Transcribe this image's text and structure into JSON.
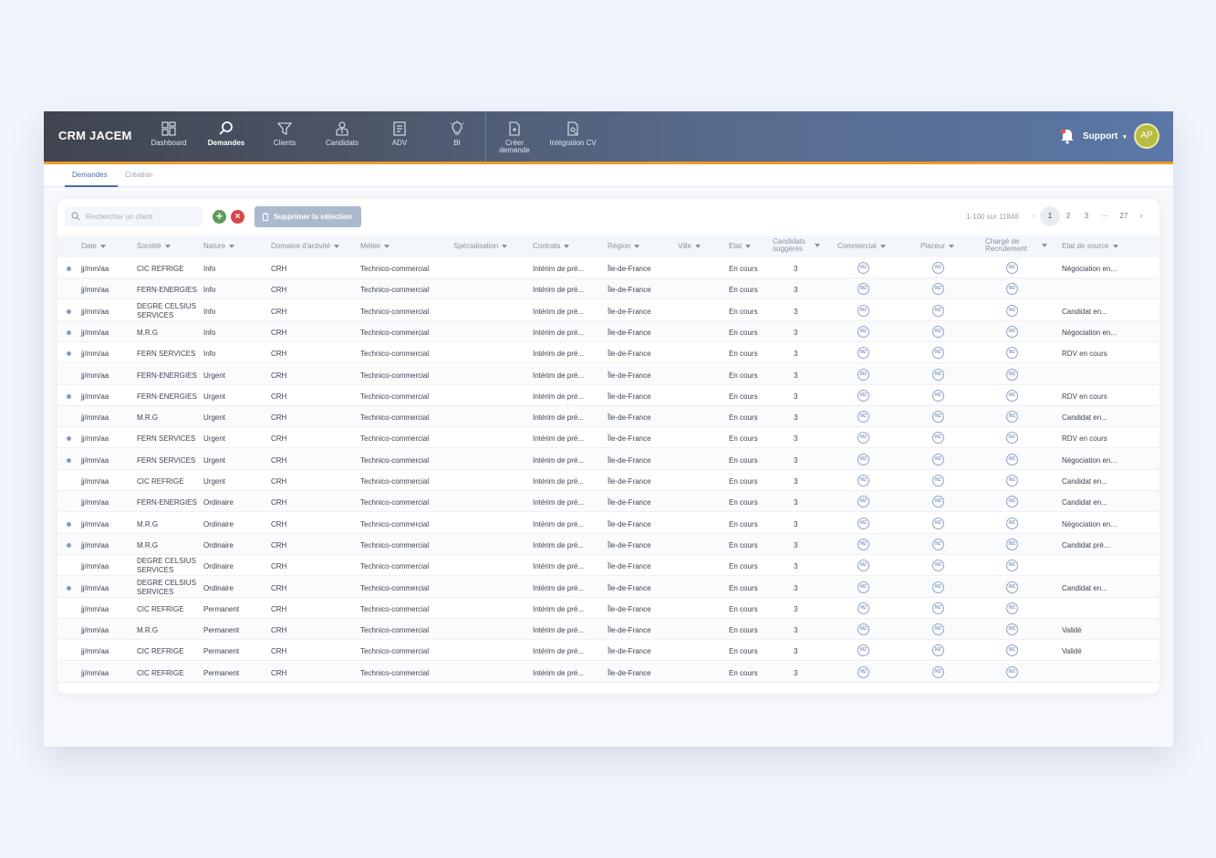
{
  "app": {
    "title": "CRM JACEM"
  },
  "nav": {
    "items": [
      {
        "label": "Dashboard",
        "icon": "dashboard-icon",
        "active": false
      },
      {
        "label": "Demandes",
        "icon": "search-icon",
        "active": true
      },
      {
        "label": "Clients",
        "icon": "funnel-icon",
        "active": false
      },
      {
        "label": "Candidats",
        "icon": "person-icon",
        "active": false
      },
      {
        "label": "ADV",
        "icon": "document-icon",
        "active": false
      },
      {
        "label": "BI",
        "icon": "lightbulb-icon",
        "active": false
      }
    ],
    "actions": [
      {
        "label": "Créer demande",
        "icon": "new-document-icon"
      },
      {
        "label": "Intégration CV",
        "icon": "cv-document-icon"
      }
    ]
  },
  "user": {
    "menu_label": "Support",
    "initials": "AP",
    "avatar_color": "#b7bb3f"
  },
  "subtabs": [
    {
      "label": "Demandes",
      "active": true
    },
    {
      "label": "Création",
      "active": false
    }
  ],
  "toolbar": {
    "search_placeholder": "Rechercher un client",
    "add_label": "+",
    "remove_label": "×",
    "delete_selection_label": "Supprimer la sélection"
  },
  "pagination": {
    "info": "1-100 sur 11848",
    "pages": [
      "1",
      "2",
      "3",
      "···",
      "27"
    ],
    "current": "1",
    "prev": "‹",
    "next": "›"
  },
  "table": {
    "columns": [
      {
        "label": "Date"
      },
      {
        "label": "Société"
      },
      {
        "label": "Nature"
      },
      {
        "label": "Domaine d'activité"
      },
      {
        "label": "Métier"
      },
      {
        "label": "Spécialisation"
      },
      {
        "label": "Contrats"
      },
      {
        "label": "Région"
      },
      {
        "label": "Ville"
      },
      {
        "label": "Etat"
      },
      {
        "label": "Candidats suggérés"
      },
      {
        "label": "Commercial"
      },
      {
        "label": "Placeur"
      },
      {
        "label": "Chargé de Recrutement"
      },
      {
        "label": "Etat de source"
      }
    ],
    "avatar_initials": "MZ",
    "rows": [
      {
        "dot": true,
        "date": "jj/mm/aa",
        "societe": "CIC REFRIGE",
        "nature": "Info",
        "domaine": "CRH",
        "metier": "Technico-commercial",
        "contrat": "Intérim de pré...",
        "region": "Île-de-France",
        "etat": "En cours",
        "candidats": "3",
        "source": "Négociation en..."
      },
      {
        "dot": false,
        "date": "jj/mm/aa",
        "societe": "FERN-ENERGIES",
        "nature": "Info",
        "domaine": "CRH",
        "metier": "Technico-commercial",
        "contrat": "Intérim de pré...",
        "region": "Île-de-France",
        "etat": "En cours",
        "candidats": "3",
        "source": ""
      },
      {
        "dot": true,
        "date": "jj/mm/aa",
        "societe": "DEGRE CELSIUS SERVICES",
        "nature": "Info",
        "domaine": "CRH",
        "metier": "Technico-commercial",
        "contrat": "Intérim de pré...",
        "region": "Île-de-France",
        "etat": "En cours",
        "candidats": "3",
        "source": "Candidat en..."
      },
      {
        "dot": true,
        "date": "jj/mm/aa",
        "societe": "M.R.G",
        "nature": "Info",
        "domaine": "CRH",
        "metier": "Technico-commercial",
        "contrat": "Intérim de pré...",
        "region": "Île-de-France",
        "etat": "En cours",
        "candidats": "3",
        "source": "Négociation en..."
      },
      {
        "dot": true,
        "date": "jj/mm/aa",
        "societe": "FERN SERVICES",
        "nature": "Info",
        "domaine": "CRH",
        "metier": "Technico-commercial",
        "contrat": "Intérim de pré...",
        "region": "Île-de-France",
        "etat": "En cours",
        "candidats": "3",
        "source": "RDV en cours"
      },
      {
        "dot": false,
        "date": "jj/mm/aa",
        "societe": "FERN-ENERGIES",
        "nature": "Urgent",
        "domaine": "CRH",
        "metier": "Technico-commercial",
        "contrat": "Intérim de pré...",
        "region": "Île-de-France",
        "etat": "En cours",
        "candidats": "3",
        "source": ""
      },
      {
        "dot": true,
        "date": "jj/mm/aa",
        "societe": "FERN-ENERGIES",
        "nature": "Urgent",
        "domaine": "CRH",
        "metier": "Technico-commercial",
        "contrat": "Intérim de pré...",
        "region": "Île-de-France",
        "etat": "En cours",
        "candidats": "3",
        "source": "RDV en cours"
      },
      {
        "dot": false,
        "date": "jj/mm/aa",
        "societe": "M.R.G",
        "nature": "Urgent",
        "domaine": "CRH",
        "metier": "Technico-commercial",
        "contrat": "Intérim de pré...",
        "region": "Île-de-France",
        "etat": "En cours",
        "candidats": "3",
        "source": "Candidat en..."
      },
      {
        "dot": true,
        "date": "jj/mm/aa",
        "societe": "FERN SERVICES",
        "nature": "Urgent",
        "domaine": "CRH",
        "metier": "Technico-commercial",
        "contrat": "Intérim de pré...",
        "region": "Île-de-France",
        "etat": "En cours",
        "candidats": "3",
        "source": "RDV en cours"
      },
      {
        "dot": true,
        "date": "jj/mm/aa",
        "societe": "FERN SERVICES",
        "nature": "Urgent",
        "domaine": "CRH",
        "metier": "Technico-commercial",
        "contrat": "Intérim de pré...",
        "region": "Île-de-France",
        "etat": "En cours",
        "candidats": "3",
        "source": "Négociation en..."
      },
      {
        "dot": false,
        "date": "jj/mm/aa",
        "societe": "CIC REFRIGE",
        "nature": "Urgent",
        "domaine": "CRH",
        "metier": "Technico-commercial",
        "contrat": "Intérim de pré...",
        "region": "Île-de-France",
        "etat": "En cours",
        "candidats": "3",
        "source": "Candidat en..."
      },
      {
        "dot": false,
        "date": "jj/mm/aa",
        "societe": "FERN-ENERGIES",
        "nature": "Ordinaire",
        "domaine": "CRH",
        "metier": "Technico-commercial",
        "contrat": "Intérim de pré...",
        "region": "Île-de-France",
        "etat": "En cours",
        "candidats": "3",
        "source": "Candidat en..."
      },
      {
        "dot": true,
        "date": "jj/mm/aa",
        "societe": "M.R.G",
        "nature": "Ordinaire",
        "domaine": "CRH",
        "metier": "Technico-commercial",
        "contrat": "Intérim de pré...",
        "region": "Île-de-France",
        "etat": "En cours",
        "candidats": "3",
        "source": "Négociation en..."
      },
      {
        "dot": true,
        "date": "jj/mm/aa",
        "societe": "M.R.G",
        "nature": "Ordinaire",
        "domaine": "CRH",
        "metier": "Technico-commercial",
        "contrat": "Intérim de pré...",
        "region": "Île-de-France",
        "etat": "En cours",
        "candidats": "3",
        "source": "Candidat pré..."
      },
      {
        "dot": false,
        "date": "jj/mm/aa",
        "societe": "DEGRE CELSIUS SERVICES",
        "nature": "Ordinaire",
        "domaine": "CRH",
        "metier": "Technico-commercial",
        "contrat": "Intérim de pré...",
        "region": "Île-de-France",
        "etat": "En cours",
        "candidats": "3",
        "source": ""
      },
      {
        "dot": true,
        "date": "jj/mm/aa",
        "societe": "DEGRE CELSIUS SERVICES",
        "nature": "Ordinaire",
        "domaine": "CRH",
        "metier": "Technico-commercial",
        "contrat": "Intérim de pré...",
        "region": "Île-de-France",
        "etat": "En cours",
        "candidats": "3",
        "source": "Candidat en..."
      },
      {
        "dot": false,
        "date": "jj/mm/aa",
        "societe": "CIC REFRIGE",
        "nature": "Permanent",
        "domaine": "CRH",
        "metier": "Technico-commercial",
        "contrat": "Intérim de pré...",
        "region": "Île-de-France",
        "etat": "En cours",
        "candidats": "3",
        "source": ""
      },
      {
        "dot": false,
        "date": "jj/mm/aa",
        "societe": "M.R.G",
        "nature": "Permanent",
        "domaine": "CRH",
        "metier": "Technico-commercial",
        "contrat": "Intérim de pré...",
        "region": "Île-de-France",
        "etat": "En cours",
        "candidats": "3",
        "source": "Validé"
      },
      {
        "dot": false,
        "date": "jj/mm/aa",
        "societe": "CIC REFRIGE",
        "nature": "Permanent",
        "domaine": "CRH",
        "metier": "Technico-commercial",
        "contrat": "Intérim de pré...",
        "region": "Île-de-France",
        "etat": "En cours",
        "candidats": "3",
        "source": "Validé"
      },
      {
        "dot": false,
        "date": "jj/mm/aa",
        "societe": "CIC REFRIGE",
        "nature": "Permanent",
        "domaine": "CRH",
        "metier": "Technico-commercial",
        "contrat": "Intérim de pré...",
        "region": "Île-de-France",
        "etat": "En cours",
        "candidats": "3",
        "source": ""
      }
    ]
  },
  "colors": {
    "accent": "#4a6fa5",
    "topbar_stripe": "#ef9a2c",
    "add": "#5e9a5b",
    "remove": "#d64848"
  }
}
